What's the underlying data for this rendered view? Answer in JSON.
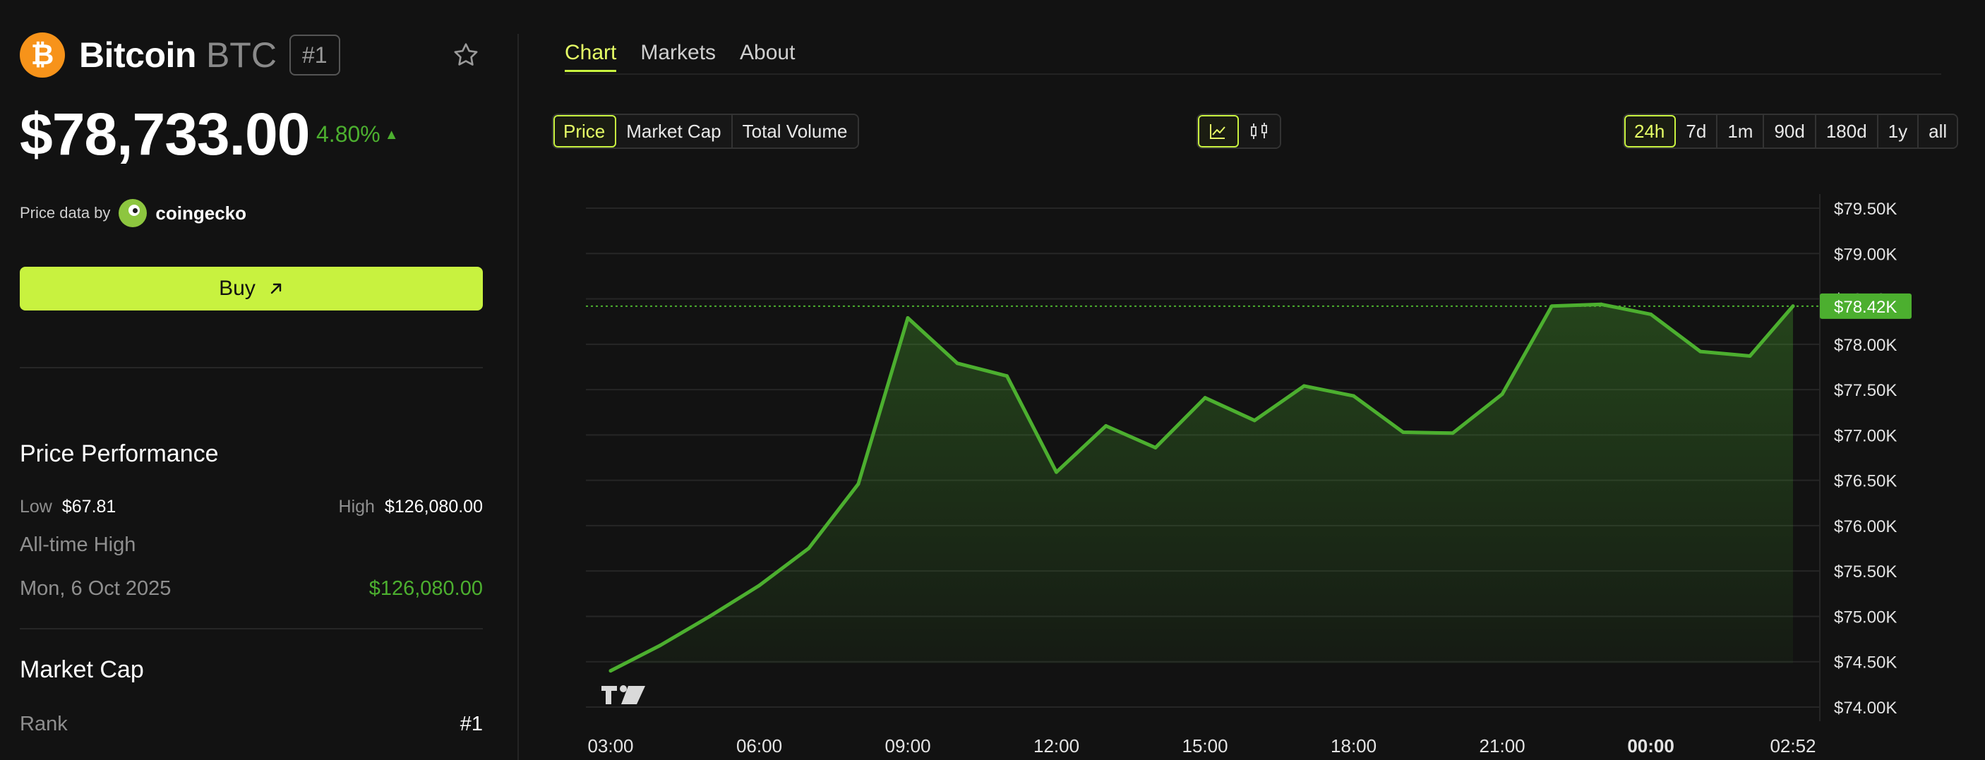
{
  "coin": {
    "name": "Bitcoin",
    "symbol": "BTC",
    "rank_badge": "#1",
    "logo_glyph": "₿",
    "price": "$78,733.00",
    "change": "4.80%",
    "change_arrow": "▲",
    "price_data_by": "Price data by",
    "provider": "coingecko",
    "buy_label": "Buy",
    "buy_icon": "arrow-up-right-icon"
  },
  "performance": {
    "title": "Price Performance",
    "low_label": "Low",
    "low_value": "$67.81",
    "high_label": "High",
    "high_value": "$126,080.00",
    "ath_label": "All-time High",
    "ath_date": "Mon, 6 Oct 2025",
    "ath_value": "$126,080.00"
  },
  "market_cap": {
    "title": "Market Cap",
    "rank_label": "Rank",
    "rank_value": "#1"
  },
  "tabs": [
    "Chart",
    "Markets",
    "About"
  ],
  "active_tab": "Chart",
  "metrics": [
    "Price",
    "Market Cap",
    "Total Volume"
  ],
  "active_metric": "Price",
  "chart_modes": [
    "line-chart-icon",
    "candlestick-icon"
  ],
  "active_chart_mode": "line-chart-icon",
  "ranges": [
    "24h",
    "7d",
    "1m",
    "90d",
    "180d",
    "1y",
    "all"
  ],
  "active_range": "24h",
  "colors": {
    "accent": "#c8f23f",
    "line": "#4caf2f",
    "bitcoin": "#f7931a",
    "background": "#121212"
  },
  "chart_data": {
    "type": "area",
    "title": "",
    "xlabel": "",
    "ylabel": "",
    "x_ticks": [
      "03:00",
      "06:00",
      "09:00",
      "12:00",
      "15:00",
      "18:00",
      "21:00",
      "00:00",
      "02:52"
    ],
    "y_ticks": [
      "$79.50K",
      "$79.00K",
      "$78.50K",
      "$78.00K",
      "$77.50K",
      "$77.00K",
      "$76.50K",
      "$76.00K",
      "$75.50K",
      "$75.00K",
      "$74.50K",
      "$74.00K"
    ],
    "ylim": [
      74000,
      79500
    ],
    "xlim_hours": [
      3.0,
      26.87
    ],
    "current_value_label": "$78.42K",
    "current_value": 78420,
    "grid": true,
    "series": [
      {
        "x_hours": [
          3.0,
          4.0,
          5.0,
          6.0,
          7.0,
          8.0,
          9.0,
          10.0,
          11.0,
          12.0,
          13.0,
          14.0,
          15.0,
          16.0,
          17.0,
          18.0,
          19.0,
          20.0,
          21.0,
          22.0,
          23.0,
          24.0,
          25.0,
          26.0,
          26.87
        ],
        "values": [
          74400,
          74680,
          75000,
          75340,
          75750,
          76460,
          78290,
          77790,
          77650,
          76590,
          77100,
          76860,
          77410,
          77160,
          77540,
          77430,
          77030,
          77020,
          77450,
          78420,
          78440,
          78330,
          77920,
          77870,
          78420
        ]
      }
    ]
  }
}
